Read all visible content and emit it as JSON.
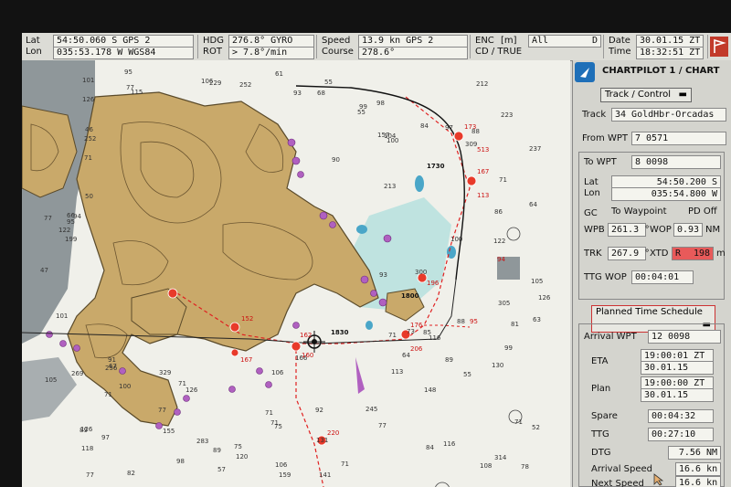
{
  "topbar": {
    "lat_label": "Lat",
    "lat_value": "54:50.060 S GPS 2",
    "lon_label": "Lon",
    "lon_value": "035:53.178 W WGS84",
    "hdg_label": "HDG",
    "hdg_value": "276.8° GYRO",
    "rot_label": "ROT",
    "rot_value": "> 7.8°/min",
    "speed_label": "Speed",
    "speed_value": "13.9 kn GPS 2",
    "course_label": "Course",
    "course_value": "278.6°",
    "enc_label": "ENC",
    "enc_unit": "[m]",
    "cd_label": "CD / TRUE",
    "enc_mode": "All",
    "enc_flag": "D",
    "date_label": "Date",
    "date_value": "30.01.15 ZT",
    "time_label": "Time",
    "time_value": "18:32:51 ZT"
  },
  "panel": {
    "title": "CHARTPILOT 1 / CHART",
    "track_control": "Track / Control",
    "track_label": "Track",
    "track_value": "34 GoldHbr-Orcadas",
    "from_wpt_label": "From WPT",
    "from_wpt_value": "7 0571",
    "to_wpt_label": "To WPT",
    "to_wpt_value": "8 0098",
    "lat_label": "Lat",
    "lat_value": "54:50.200 S",
    "lon_label": "Lon",
    "lon_value": "035:54.800 W",
    "gc_label": "GC",
    "to_waypoint_label": "To Waypoint",
    "pd_label": "PD Off",
    "wpb_label": "WPB",
    "wpb_value": "261.3 °",
    "wop_label": "WOP",
    "wop_value": "0.93",
    "wop_unit": "NM",
    "trk_label": "TRK",
    "trk_value": "267.9 °",
    "xtd_label": "XTD",
    "xtd_side": "R",
    "xtd_value": "198",
    "xtd_unit": "m",
    "ttg_wop_label": "TTG WOP",
    "ttg_wop_value": "00:04:01",
    "schedule": "Planned Time Schedule",
    "arrival_wpt_label": "Arrival WPT",
    "arrival_wpt_value": "12 0098",
    "eta_label": "ETA",
    "eta_time": "19:00:01 ZT",
    "eta_date": "30.01.15",
    "plan_label": "Plan",
    "plan_time": "19:00:00 ZT",
    "plan_date": "30.01.15",
    "spare_label": "Spare",
    "spare_value": "00:04:32",
    "ttg_label": "TTG",
    "ttg_value": "00:27:10",
    "dtg_label": "DTG",
    "dtg_value": "7.56 NM",
    "arrival_speed_label": "Arrival Speed",
    "arrival_speed_value": "16.6 kn",
    "next_speed_label": "Next Speed",
    "next_speed_value": "16.6 kn"
  },
  "map": {
    "depths": [
      "126",
      "126",
      "98",
      "104",
      "115",
      "78",
      "237",
      "213",
      "82",
      "100",
      "118",
      "155",
      "116",
      "199",
      "71",
      "64",
      "71",
      "84",
      "71",
      "108",
      "71",
      "85",
      "55",
      "113",
      "98",
      "77",
      "77",
      "75",
      "71",
      "71",
      "64",
      "77",
      "77",
      "77",
      "101",
      "92",
      "88",
      "93",
      "94",
      "97",
      "95",
      "99",
      "105",
      "106",
      "89",
      "73",
      "89",
      "126",
      "101",
      "131",
      "97",
      "93",
      "99",
      "106",
      "122",
      "166",
      "116",
      "141",
      "245",
      "126",
      "148",
      "130",
      "95",
      "159",
      "157",
      "100",
      "106",
      "105",
      "122",
      "329",
      "283",
      "309",
      "305",
      "252",
      "229",
      "269",
      "223",
      "252",
      "256",
      "212",
      "300",
      "314",
      "120",
      "100",
      "71",
      "67",
      "71",
      "81",
      "89",
      "91",
      "63",
      "55",
      "46",
      "75",
      "84",
      "71",
      "86",
      "66",
      "57",
      "88",
      "68",
      "90",
      "47",
      "61",
      "55",
      "50",
      "52"
    ],
    "wpt_labels": [
      "173",
      "167",
      "513",
      "113",
      "94",
      "196",
      "176",
      "95",
      "206",
      "160",
      "162",
      "152",
      "167",
      "220"
    ],
    "black_labels": [
      "1730",
      "1800",
      "1830"
    ]
  }
}
